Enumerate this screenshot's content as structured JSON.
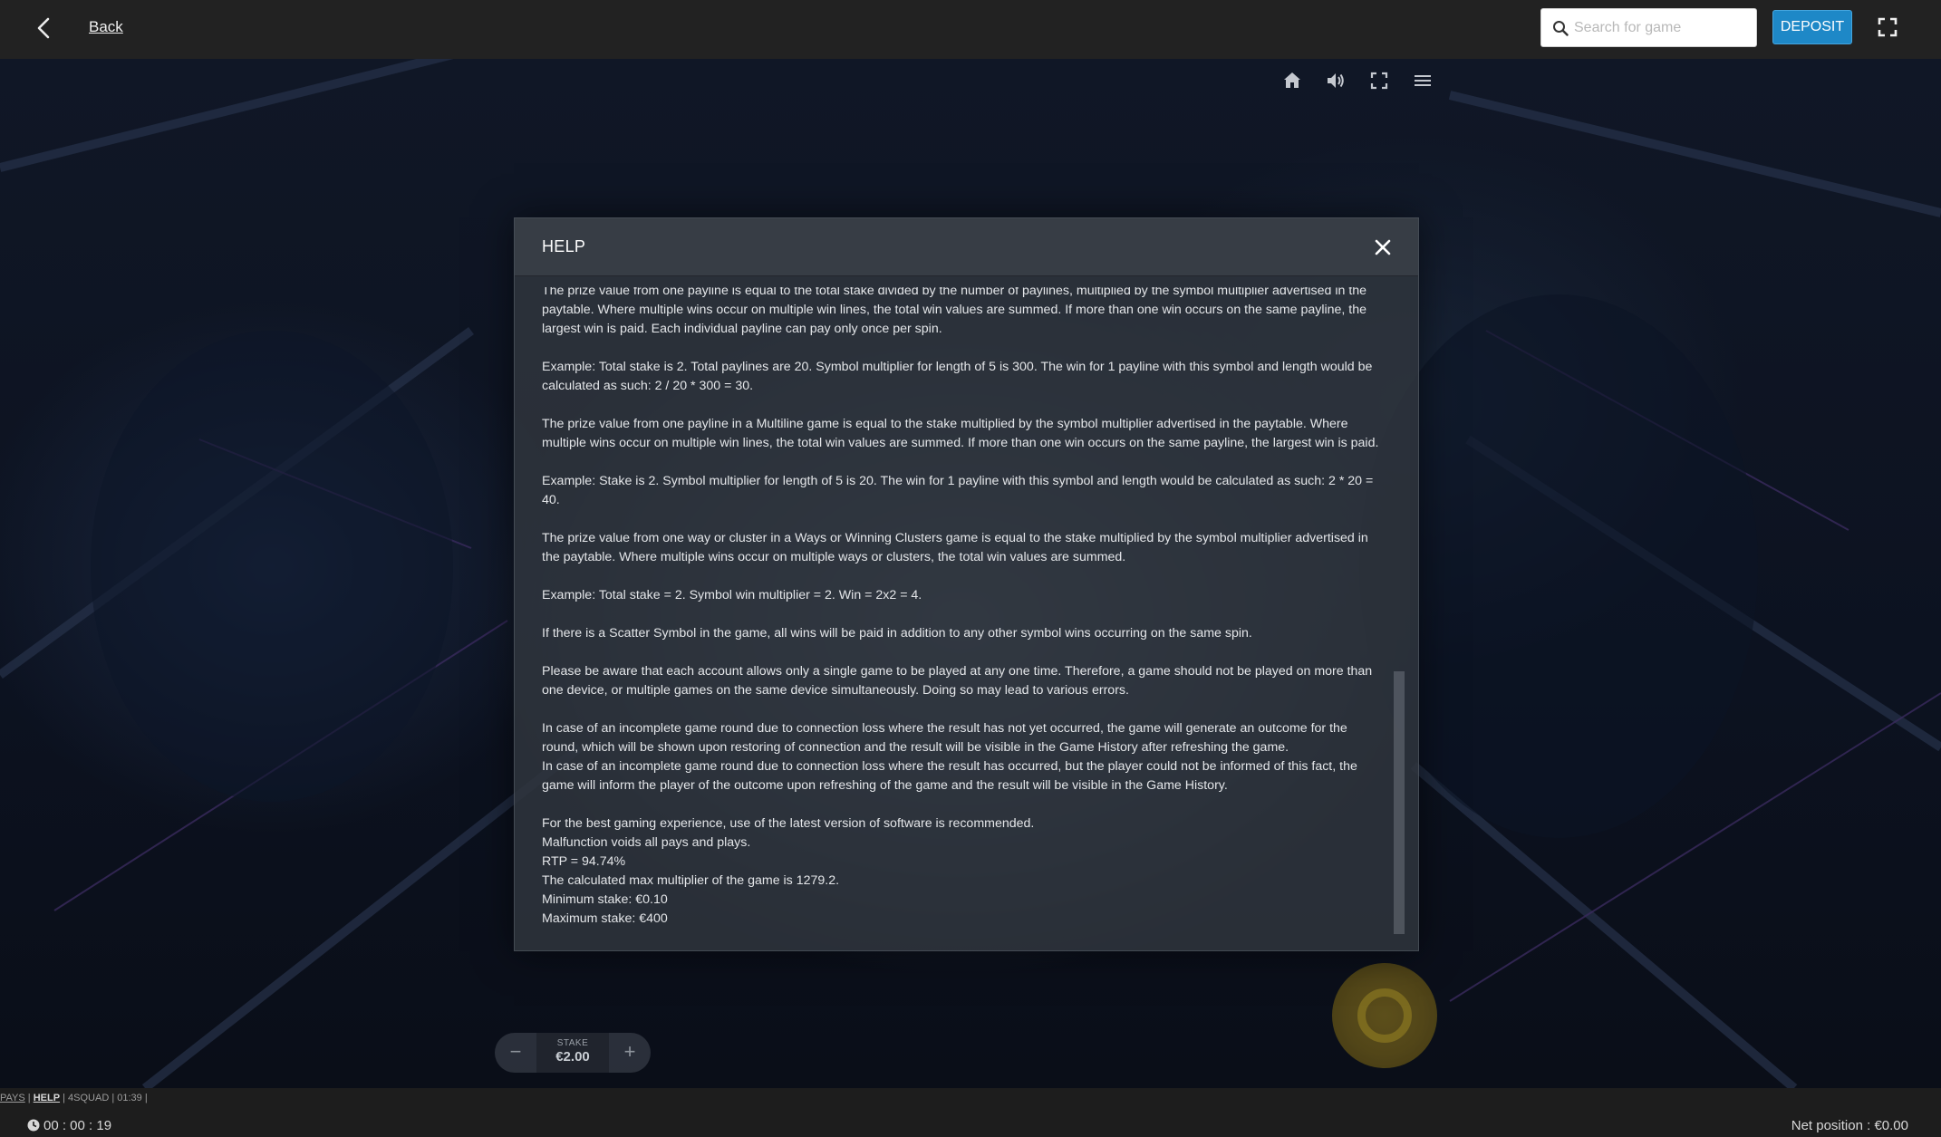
{
  "topbar": {
    "back_label": "Back",
    "search_placeholder": "Search for game",
    "search_value": "",
    "deposit_label": "DEPOSIT"
  },
  "game": {
    "controls": [
      "home-icon",
      "volume-icon",
      "fullscreen-icon",
      "menu-icon"
    ],
    "stake_label": "STAKE",
    "stake_value": "€2.00",
    "stake_minus": "−",
    "stake_plus": "+"
  },
  "modal": {
    "title": "HELP",
    "paragraphs": [
      "The prize value from one payline is equal to the total stake divided by the number of paylines, multiplied by the symbol multiplier advertised in the paytable. Where multiple wins occur on multiple win lines, the total win values are summed. If more than one win occurs on the same payline, the largest win is paid. Each individual payline can pay only once per spin.",
      "Example: Total stake is 2. Total paylines are 20. Symbol multiplier for length of 5 is 300. The win for 1 payline with this symbol and length would be calculated as such: 2 / 20 * 300 = 30.",
      "The prize value from one payline in a Multiline game is equal to the stake multiplied by the symbol multiplier advertised in the paytable. Where multiple wins occur on multiple win lines, the total win values are summed. If more than one win occurs on the same payline, the largest win is paid.",
      "Example: Stake is 2. Symbol multiplier for length of 5 is 20. The win for 1 payline with this symbol and length would be calculated as such: 2 * 20 = 40.",
      "The prize value from one way or cluster in a Ways or Winning Clusters game is equal to the stake multiplied by the symbol multiplier advertised in the paytable. Where multiple wins occur on multiple ways or clusters, the total win values are summed.",
      "Example: Total stake = 2. Symbol win multiplier = 2. Win = 2x2 = 4.",
      "If there is a Scatter Symbol in the game, all wins will be paid in addition to any other symbol wins occurring on the same spin.",
      "Please be aware that each account allows only a single game to be played at any one time. Therefore, a game should not be played on more than one device, or multiple games on the same device simultaneously. Doing so may lead to various errors.",
      "In case of an incomplete game round due to connection loss where the result has not yet occurred, the game will generate an outcome for the round, which will be shown upon restoring of connection and the result will be visible in the Game History after refreshing the game.",
      "In case of an incomplete game round due to connection loss where the result has occurred, but the player could not be informed of this fact, the game will inform the player of the outcome upon refreshing of the game and the result will be visible in the Game History.",
      "For the best gaming experience, use of the latest version of software is recommended.",
      "Malfunction voids all pays and plays.",
      "RTP = 94.74%",
      "The calculated max multiplier of the game is 1279.2.",
      "Minimum stake: €0.10",
      "Maximum stake: €400"
    ]
  },
  "footer": {
    "links": [
      "PAYS",
      "HELP",
      "4SQUAD",
      "01:39"
    ],
    "timer": "00 : 00 : 19",
    "net_position": "Net position : €0.00"
  }
}
